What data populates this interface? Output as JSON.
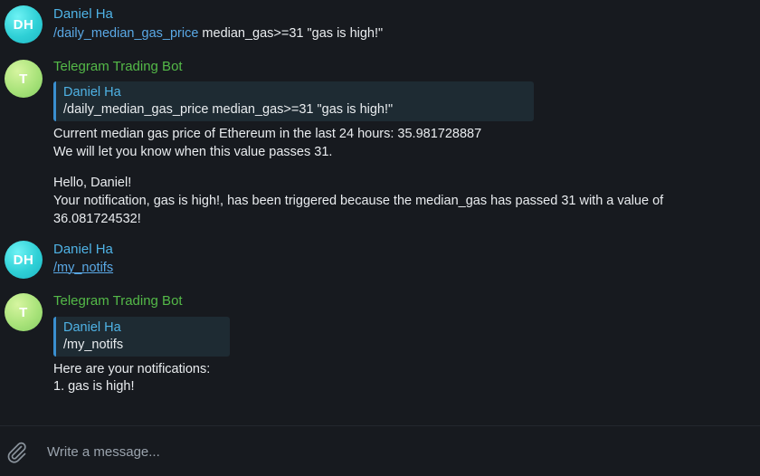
{
  "messages": [
    {
      "avatar": "DH",
      "sender": "Daniel Ha",
      "command": "/daily_median_gas_price",
      "text": " median_gas>=31 \"gas is high!\""
    },
    {
      "avatar": "T",
      "sender": "Telegram Trading Bot",
      "reply_to": {
        "name": "Daniel Ha",
        "text": "/daily_median_gas_price median_gas>=31 \"gas is high!\""
      },
      "lines": [
        "Current median gas price of Ethereum in the last 24 hours: 35.981728887",
        "We will let you know when this value passes 31.",
        "",
        "Hello, Daniel!",
        "Your notification, gas is high!, has been triggered because the median_gas has passed 31 with a value of",
        "36.081724532!"
      ]
    },
    {
      "avatar": "DH",
      "sender": "Daniel Ha",
      "command": "/my_notifs"
    },
    {
      "avatar": "T",
      "sender": "Telegram Trading Bot",
      "reply_to": {
        "name": "Daniel Ha",
        "text": "/my_notifs"
      },
      "lines": [
        "Here are your notifications:",
        "1. gas is high!"
      ]
    }
  ],
  "composer": {
    "placeholder": "Write a message..."
  },
  "icons": {
    "attach": "paperclip-icon"
  },
  "colors": {
    "user_name": "#4fb3e6",
    "bot_name": "#54b948",
    "link": "#5aa9e6",
    "background": "#171a1f"
  }
}
